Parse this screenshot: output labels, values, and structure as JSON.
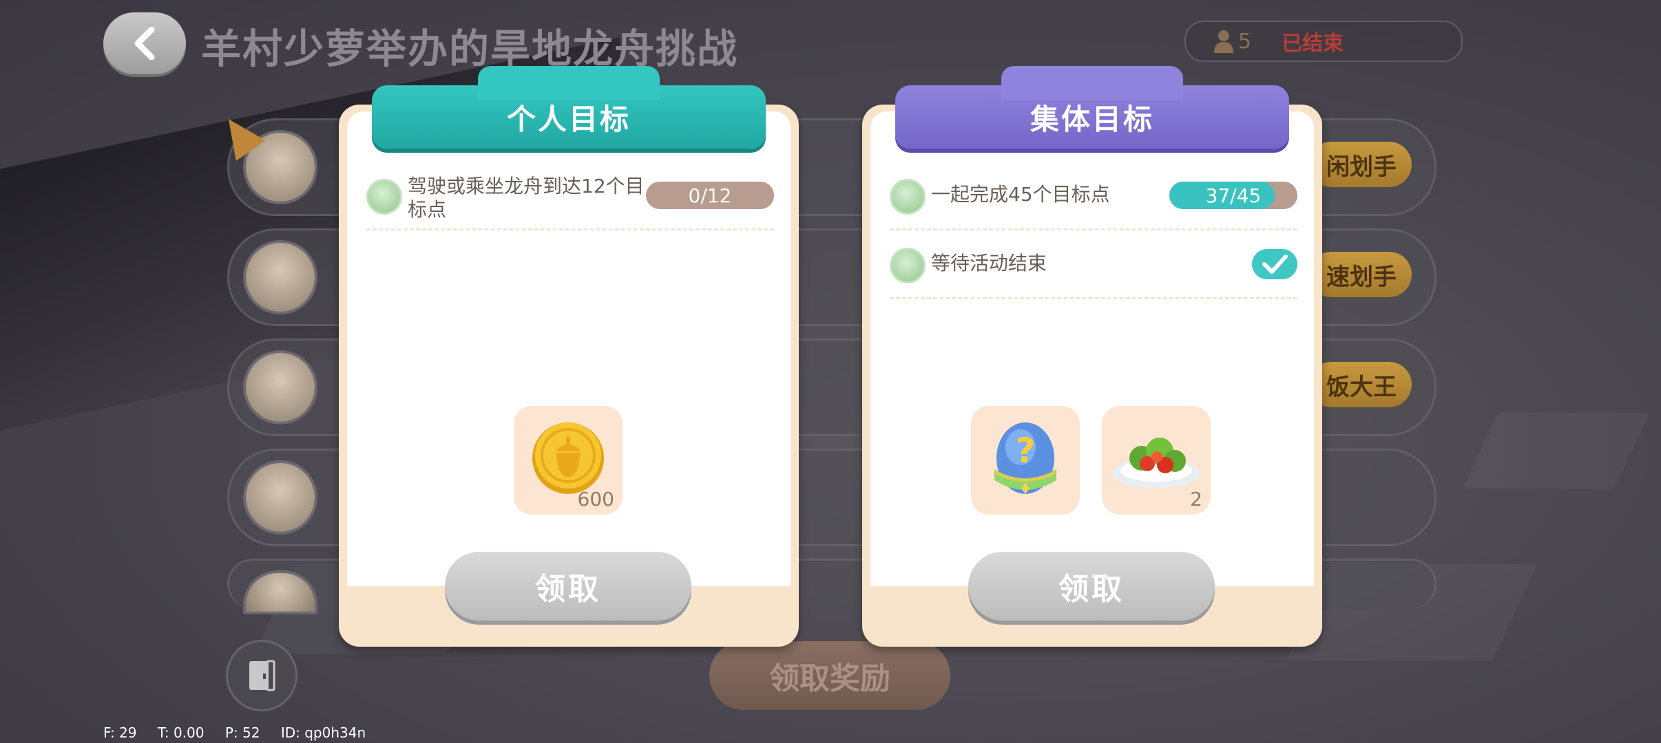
{
  "header": {
    "title": "羊村少萝举办的旱地龙舟挑战",
    "player_count": "5",
    "status": "已结束"
  },
  "players": [
    {
      "badge": "闲划手"
    },
    {
      "badge": "速划手"
    },
    {
      "badge": "饭大王"
    },
    {
      "badge": ""
    },
    {
      "badge": ""
    }
  ],
  "personal": {
    "title": "个人目标",
    "tasks": [
      {
        "text": "驾驶或乘坐龙舟到达12个目标点",
        "progress_label": "0/12",
        "progress": 0.0
      }
    ],
    "rewards": [
      {
        "icon": "acorn-coin-icon",
        "qty": "600"
      }
    ],
    "claim": "领取"
  },
  "collective": {
    "title": "集体目标",
    "tasks": [
      {
        "text": "一起完成45个目标点",
        "progress_label": "37/45",
        "progress": 0.822
      },
      {
        "text": "等待活动结束",
        "done": true
      }
    ],
    "rewards": [
      {
        "icon": "mystery-egg-icon",
        "qty": ""
      },
      {
        "icon": "salad-plate-icon",
        "qty": "2"
      }
    ],
    "claim": "领取"
  },
  "footer": {
    "claim_all": "领取奖励"
  },
  "debug": {
    "f": "F: 29",
    "t": "T: 0.00",
    "p": "P: 52",
    "id": "ID: qp0h34n"
  },
  "colors": {
    "teal": "#34c6c0",
    "purple": "#8f83dd",
    "panel_bg": "#f8e4ca",
    "progress_track": "#b79c8f"
  }
}
